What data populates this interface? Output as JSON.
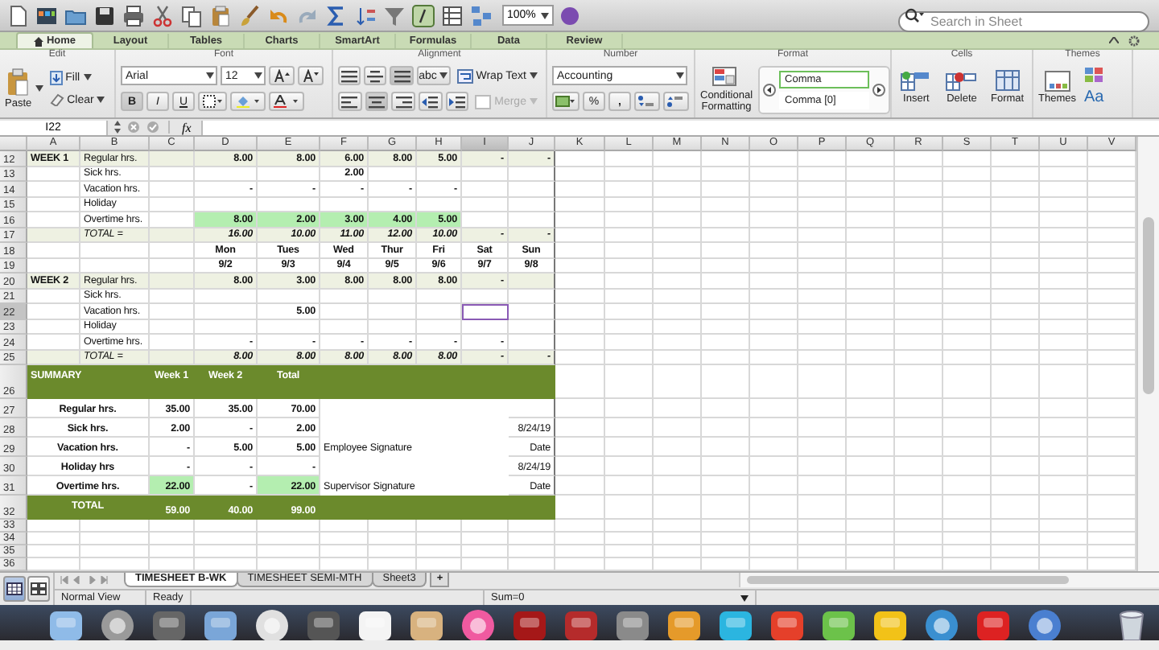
{
  "toolbar": {
    "zoom": "100%",
    "search": {
      "placeholder": "Search in Sheet"
    }
  },
  "ribbon_tabs": [
    {
      "label": "Home",
      "selected": true
    },
    {
      "label": "Layout",
      "selected": false
    },
    {
      "label": "Tables",
      "selected": false
    },
    {
      "label": "Charts",
      "selected": false
    },
    {
      "label": "SmartArt",
      "selected": false
    },
    {
      "label": "Formulas",
      "selected": false
    },
    {
      "label": "Data",
      "selected": false
    },
    {
      "label": "Review",
      "selected": false
    }
  ],
  "ribbon": {
    "edit": {
      "title": "Edit",
      "paste": "Paste",
      "fill": "Fill",
      "clear": "Clear"
    },
    "font": {
      "title": "Font",
      "name": "Arial",
      "size": "12",
      "bold": "B",
      "italic": "I",
      "underline": "U"
    },
    "alignment": {
      "title": "Alignment",
      "orientation": "abc",
      "wrap": "Wrap Text",
      "merge": {
        "label": "Merge",
        "disabled": true
      }
    },
    "number": {
      "title": "Number",
      "format": "Accounting",
      "percent": "%",
      "comma": ","
    },
    "format": {
      "title": "Format",
      "conditional": "Conditional Formatting",
      "styles": [
        {
          "label": "Comma",
          "selected": true
        },
        {
          "label": "Comma [0]",
          "selected": false
        }
      ]
    },
    "cells": {
      "title": "Cells",
      "buttons": [
        "Insert",
        "Delete",
        "Format"
      ]
    },
    "themes": {
      "title": "Themes",
      "themes_button": "Themes",
      "fonts_button": "Aa"
    }
  },
  "formula_bar": {
    "name_box": "I22",
    "function_button": "fx"
  },
  "sheet": {
    "columns": [
      {
        "label": "A",
        "selected": false
      },
      {
        "label": "B",
        "selected": false
      },
      {
        "label": "C",
        "selected": false
      },
      {
        "label": "D",
        "selected": false
      },
      {
        "label": "E",
        "selected": false
      },
      {
        "label": "F",
        "selected": false
      },
      {
        "label": "G",
        "selected": false
      },
      {
        "label": "H",
        "selected": false
      },
      {
        "label": "I",
        "selected": true
      },
      {
        "label": "J",
        "selected": false
      },
      {
        "label": "K",
        "selected": false
      },
      {
        "label": "L",
        "selected": false
      },
      {
        "label": "M",
        "selected": false
      },
      {
        "label": "N",
        "selected": false
      },
      {
        "label": "O",
        "selected": false
      },
      {
        "label": "P",
        "selected": false
      },
      {
        "label": "Q",
        "selected": false
      },
      {
        "label": "R",
        "selected": false
      },
      {
        "label": "S",
        "selected": false
      },
      {
        "label": "T",
        "selected": false
      },
      {
        "label": "U",
        "selected": false
      },
      {
        "label": "V",
        "selected": false
      }
    ],
    "rows": [
      {
        "label": "12",
        "selected": false,
        "kind": "band",
        "cells": {
          "A": "WEEK 1",
          "B": "Regular hrs.",
          "D": "8.00",
          "E": "8.00",
          "F": "6.00",
          "G": "8.00",
          "H": "5.00",
          "I": "-",
          "J": "-"
        }
      },
      {
        "label": "13",
        "selected": false,
        "kind": "plain",
        "cells": {
          "B": "Sick hrs.",
          "F": "2.00"
        }
      },
      {
        "label": "14",
        "selected": false,
        "kind": "plain",
        "cells": {
          "B": "Vacation hrs.",
          "D": "-",
          "E": "-",
          "F": "-",
          "G": "-",
          "H": "-"
        }
      },
      {
        "label": "15",
        "selected": false,
        "kind": "plain",
        "cells": {
          "B": "Holiday"
        }
      },
      {
        "label": "16",
        "selected": false,
        "kind": "plain",
        "cells": {
          "B": "Overtime hrs.",
          "D": {
            "text": "8.00",
            "kind": "highlight"
          },
          "E": {
            "text": "2.00",
            "kind": "highlight"
          },
          "F": {
            "text": "3.00",
            "kind": "highlight"
          },
          "G": {
            "text": "4.00",
            "kind": "highlight"
          },
          "H": {
            "text": "5.00",
            "kind": "highlight"
          }
        }
      },
      {
        "label": "17",
        "selected": false,
        "kind": "total",
        "cells": {
          "B": "TOTAL =",
          "D": "16.00",
          "E": "10.00",
          "F": "11.00",
          "G": "12.00",
          "H": "10.00",
          "I": "-",
          "J": "-"
        }
      },
      {
        "label": "18",
        "selected": false,
        "kind": "days",
        "cells": {
          "D": "Mon",
          "E": "Tues",
          "F": "Wed",
          "G": "Thur",
          "H": "Fri",
          "I": "Sat",
          "J": "Sun"
        }
      },
      {
        "label": "19",
        "selected": false,
        "kind": "days",
        "cells": {
          "D": "9/2",
          "E": "9/3",
          "F": "9/4",
          "G": "9/5",
          "H": "9/6",
          "I": "9/7",
          "J": "9/8"
        }
      },
      {
        "label": "20",
        "selected": false,
        "kind": "band",
        "cells": {
          "A": "WEEK 2",
          "B": "Regular hrs.",
          "D": "8.00",
          "E": "3.00",
          "F": "8.00",
          "G": "8.00",
          "H": "8.00",
          "I": "-"
        }
      },
      {
        "label": "21",
        "selected": false,
        "kind": "plain",
        "cells": {
          "B": "Sick hrs."
        }
      },
      {
        "label": "22",
        "selected": true,
        "kind": "plain",
        "cells": {
          "B": "Vacation hrs.",
          "E": "5.00"
        }
      },
      {
        "label": "23",
        "selected": false,
        "kind": "plain",
        "cells": {
          "B": "Holiday"
        }
      },
      {
        "label": "24",
        "selected": false,
        "kind": "plain",
        "cells": {
          "B": "Overtime hrs.",
          "D": "-",
          "E": "-",
          "F": "-",
          "G": "-",
          "H": "-",
          "I": "-"
        }
      },
      {
        "label": "25",
        "selected": false,
        "kind": "total",
        "cells": {
          "B": "TOTAL =",
          "D": "8.00",
          "E": "8.00",
          "F": "8.00",
          "G": "8.00",
          "H": "8.00",
          "I": "-",
          "J": "-"
        }
      },
      {
        "label": "26",
        "selected": false,
        "kind": "summary-head",
        "cells": {
          "A": "SUMMARY",
          "C": "Week 1",
          "D": "Week 2",
          "E": "Total"
        }
      },
      {
        "label": "27",
        "selected": false,
        "kind": "summary",
        "cells": {
          "A": "Regular hrs.",
          "C": "35.00",
          "D": "35.00",
          "E": "70.00"
        }
      },
      {
        "label": "28",
        "selected": false,
        "kind": "summary",
        "cells": {
          "A": "Sick hrs.",
          "C": "2.00",
          "D": "-",
          "E": "2.00",
          "J": "8/24/19"
        }
      },
      {
        "label": "29",
        "selected": false,
        "kind": "summary",
        "cells": {
          "A": "Vacation hrs.",
          "C": "-",
          "D": "5.00",
          "E": "5.00",
          "F": "Employee Signature",
          "J": "Date"
        }
      },
      {
        "label": "30",
        "selected": false,
        "kind": "summary",
        "cells": {
          "A": "Holiday hrs",
          "C": "-",
          "D": "-",
          "E": "-",
          "J": "8/24/19"
        }
      },
      {
        "label": "31",
        "selected": false,
        "kind": "summary",
        "cells": {
          "A": "Overtime hrs.",
          "C": {
            "text": "22.00",
            "kind": "highlight"
          },
          "D": "-",
          "E": {
            "text": "22.00",
            "kind": "highlight"
          },
          "F": "Supervisor Signature",
          "J": "Date"
        }
      },
      {
        "label": "32",
        "selected": false,
        "kind": "summary-total",
        "cells": {
          "A": "TOTAL",
          "C": "59.00",
          "D": "40.00",
          "E": "99.00"
        }
      },
      {
        "label": "33",
        "selected": false,
        "kind": "empty",
        "cells": {}
      },
      {
        "label": "34",
        "selected": false,
        "kind": "empty",
        "cells": {}
      },
      {
        "label": "35",
        "selected": false,
        "kind": "empty",
        "cells": {}
      },
      {
        "label": "36",
        "selected": false,
        "kind": "empty",
        "cells": {}
      }
    ]
  },
  "sheet_tabs": [
    {
      "label": "TIMESHEET B-WK",
      "selected": true
    },
    {
      "label": "TIMESHEET SEMI-MTH",
      "selected": false
    },
    {
      "label": "Sheet3",
      "selected": false
    }
  ],
  "add_sheet": "+",
  "status_bar": {
    "view": "Normal View",
    "state": "Ready",
    "sum": "Sum=0"
  }
}
